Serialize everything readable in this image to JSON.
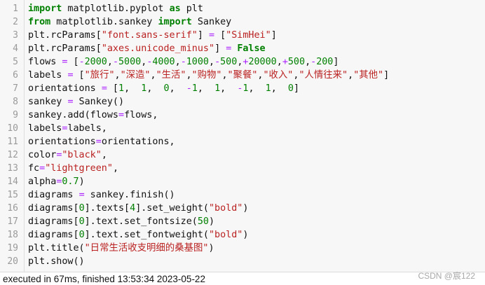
{
  "code_lines": [
    [
      [
        "kw",
        "import"
      ],
      [
        "t",
        " matplotlib.pyplot "
      ],
      [
        "kw",
        "as"
      ],
      [
        "t",
        " plt"
      ]
    ],
    [
      [
        "kw",
        "from"
      ],
      [
        "t",
        " matplotlib.sankey "
      ],
      [
        "kw",
        "import"
      ],
      [
        "t",
        " Sankey"
      ]
    ],
    [
      [
        "t",
        "plt.rcParams["
      ],
      [
        "str",
        "\"font.sans-serif\""
      ],
      [
        "t",
        "] "
      ],
      [
        "op",
        "="
      ],
      [
        "t",
        " ["
      ],
      [
        "str",
        "\"SimHei\""
      ],
      [
        "t",
        "]"
      ]
    ],
    [
      [
        "t",
        "plt.rcParams["
      ],
      [
        "str",
        "\"axes.unicode_minus\""
      ],
      [
        "t",
        "] "
      ],
      [
        "op",
        "="
      ],
      [
        "t",
        " "
      ],
      [
        "kw",
        "False"
      ]
    ],
    [
      [
        "t",
        "flows "
      ],
      [
        "op",
        "="
      ],
      [
        "t",
        " ["
      ],
      [
        "op",
        "-"
      ],
      [
        "num",
        "2000"
      ],
      [
        "t",
        ","
      ],
      [
        "op",
        "-"
      ],
      [
        "num",
        "5000"
      ],
      [
        "t",
        ","
      ],
      [
        "op",
        "-"
      ],
      [
        "num",
        "4000"
      ],
      [
        "t",
        ","
      ],
      [
        "op",
        "-"
      ],
      [
        "num",
        "1000"
      ],
      [
        "t",
        ","
      ],
      [
        "op",
        "-"
      ],
      [
        "num",
        "500"
      ],
      [
        "t",
        ","
      ],
      [
        "op",
        "+"
      ],
      [
        "num",
        "20000"
      ],
      [
        "t",
        ","
      ],
      [
        "op",
        "+"
      ],
      [
        "num",
        "500"
      ],
      [
        "t",
        ","
      ],
      [
        "op",
        "-"
      ],
      [
        "num",
        "200"
      ],
      [
        "t",
        "]"
      ]
    ],
    [
      [
        "t",
        "labels "
      ],
      [
        "op",
        "="
      ],
      [
        "t",
        " ["
      ],
      [
        "str",
        "\"旅行\""
      ],
      [
        "t",
        ","
      ],
      [
        "str",
        "\"深造\""
      ],
      [
        "t",
        ","
      ],
      [
        "str",
        "\"生活\""
      ],
      [
        "t",
        ","
      ],
      [
        "str",
        "\"购物\""
      ],
      [
        "t",
        ","
      ],
      [
        "str",
        "\"聚餐\""
      ],
      [
        "t",
        ","
      ],
      [
        "str",
        "\"收入\""
      ],
      [
        "t",
        ","
      ],
      [
        "str",
        "\"人情往来\""
      ],
      [
        "t",
        ","
      ],
      [
        "str",
        "\"其他\""
      ],
      [
        "t",
        "]"
      ]
    ],
    [
      [
        "t",
        "orientations "
      ],
      [
        "op",
        "="
      ],
      [
        "t",
        " ["
      ],
      [
        "num",
        "1"
      ],
      [
        "t",
        ",  "
      ],
      [
        "num",
        "1"
      ],
      [
        "t",
        ",  "
      ],
      [
        "num",
        "0"
      ],
      [
        "t",
        ",  "
      ],
      [
        "op",
        "-"
      ],
      [
        "num",
        "1"
      ],
      [
        "t",
        ",  "
      ],
      [
        "num",
        "1"
      ],
      [
        "t",
        ",  "
      ],
      [
        "op",
        "-"
      ],
      [
        "num",
        "1"
      ],
      [
        "t",
        ",  "
      ],
      [
        "num",
        "1"
      ],
      [
        "t",
        ",  "
      ],
      [
        "num",
        "0"
      ],
      [
        "t",
        "]"
      ]
    ],
    [
      [
        "t",
        "sankey "
      ],
      [
        "op",
        "="
      ],
      [
        "t",
        " Sankey()"
      ]
    ],
    [
      [
        "t",
        "sankey.add(flows"
      ],
      [
        "op",
        "="
      ],
      [
        "t",
        "flows,"
      ]
    ],
    [
      [
        "t",
        "labels"
      ],
      [
        "op",
        "="
      ],
      [
        "t",
        "labels,"
      ]
    ],
    [
      [
        "t",
        "orientations"
      ],
      [
        "op",
        "="
      ],
      [
        "t",
        "orientations,"
      ]
    ],
    [
      [
        "t",
        "color"
      ],
      [
        "op",
        "="
      ],
      [
        "str",
        "\"black\""
      ],
      [
        "t",
        ","
      ]
    ],
    [
      [
        "t",
        "fc"
      ],
      [
        "op",
        "="
      ],
      [
        "str",
        "\"lightgreen\""
      ],
      [
        "t",
        ","
      ]
    ],
    [
      [
        "t",
        "alpha"
      ],
      [
        "op",
        "="
      ],
      [
        "num",
        "0.7"
      ],
      [
        "t",
        ")"
      ]
    ],
    [
      [
        "t",
        "diagrams "
      ],
      [
        "op",
        "="
      ],
      [
        "t",
        " sankey.finish()"
      ]
    ],
    [
      [
        "t",
        "diagrams["
      ],
      [
        "num",
        "0"
      ],
      [
        "t",
        "].texts["
      ],
      [
        "num",
        "4"
      ],
      [
        "t",
        "].set_weight("
      ],
      [
        "str",
        "\"bold\""
      ],
      [
        "t",
        ")"
      ]
    ],
    [
      [
        "t",
        "diagrams["
      ],
      [
        "num",
        "0"
      ],
      [
        "t",
        "].text.set_fontsize("
      ],
      [
        "num",
        "50"
      ],
      [
        "t",
        ")"
      ]
    ],
    [
      [
        "t",
        "diagrams["
      ],
      [
        "num",
        "0"
      ],
      [
        "t",
        "].text.set_fontweight("
      ],
      [
        "str",
        "\"bold\""
      ],
      [
        "t",
        ")"
      ]
    ],
    [
      [
        "t",
        "plt.title("
      ],
      [
        "str",
        "\"日常生活收支明细的桑基图\""
      ],
      [
        "t",
        ")"
      ]
    ],
    [
      [
        "t",
        "plt.show()"
      ]
    ]
  ],
  "status_text": "executed in 67ms, finished 13:53:34 2023-05-22",
  "watermark": "CSDN @宸122"
}
